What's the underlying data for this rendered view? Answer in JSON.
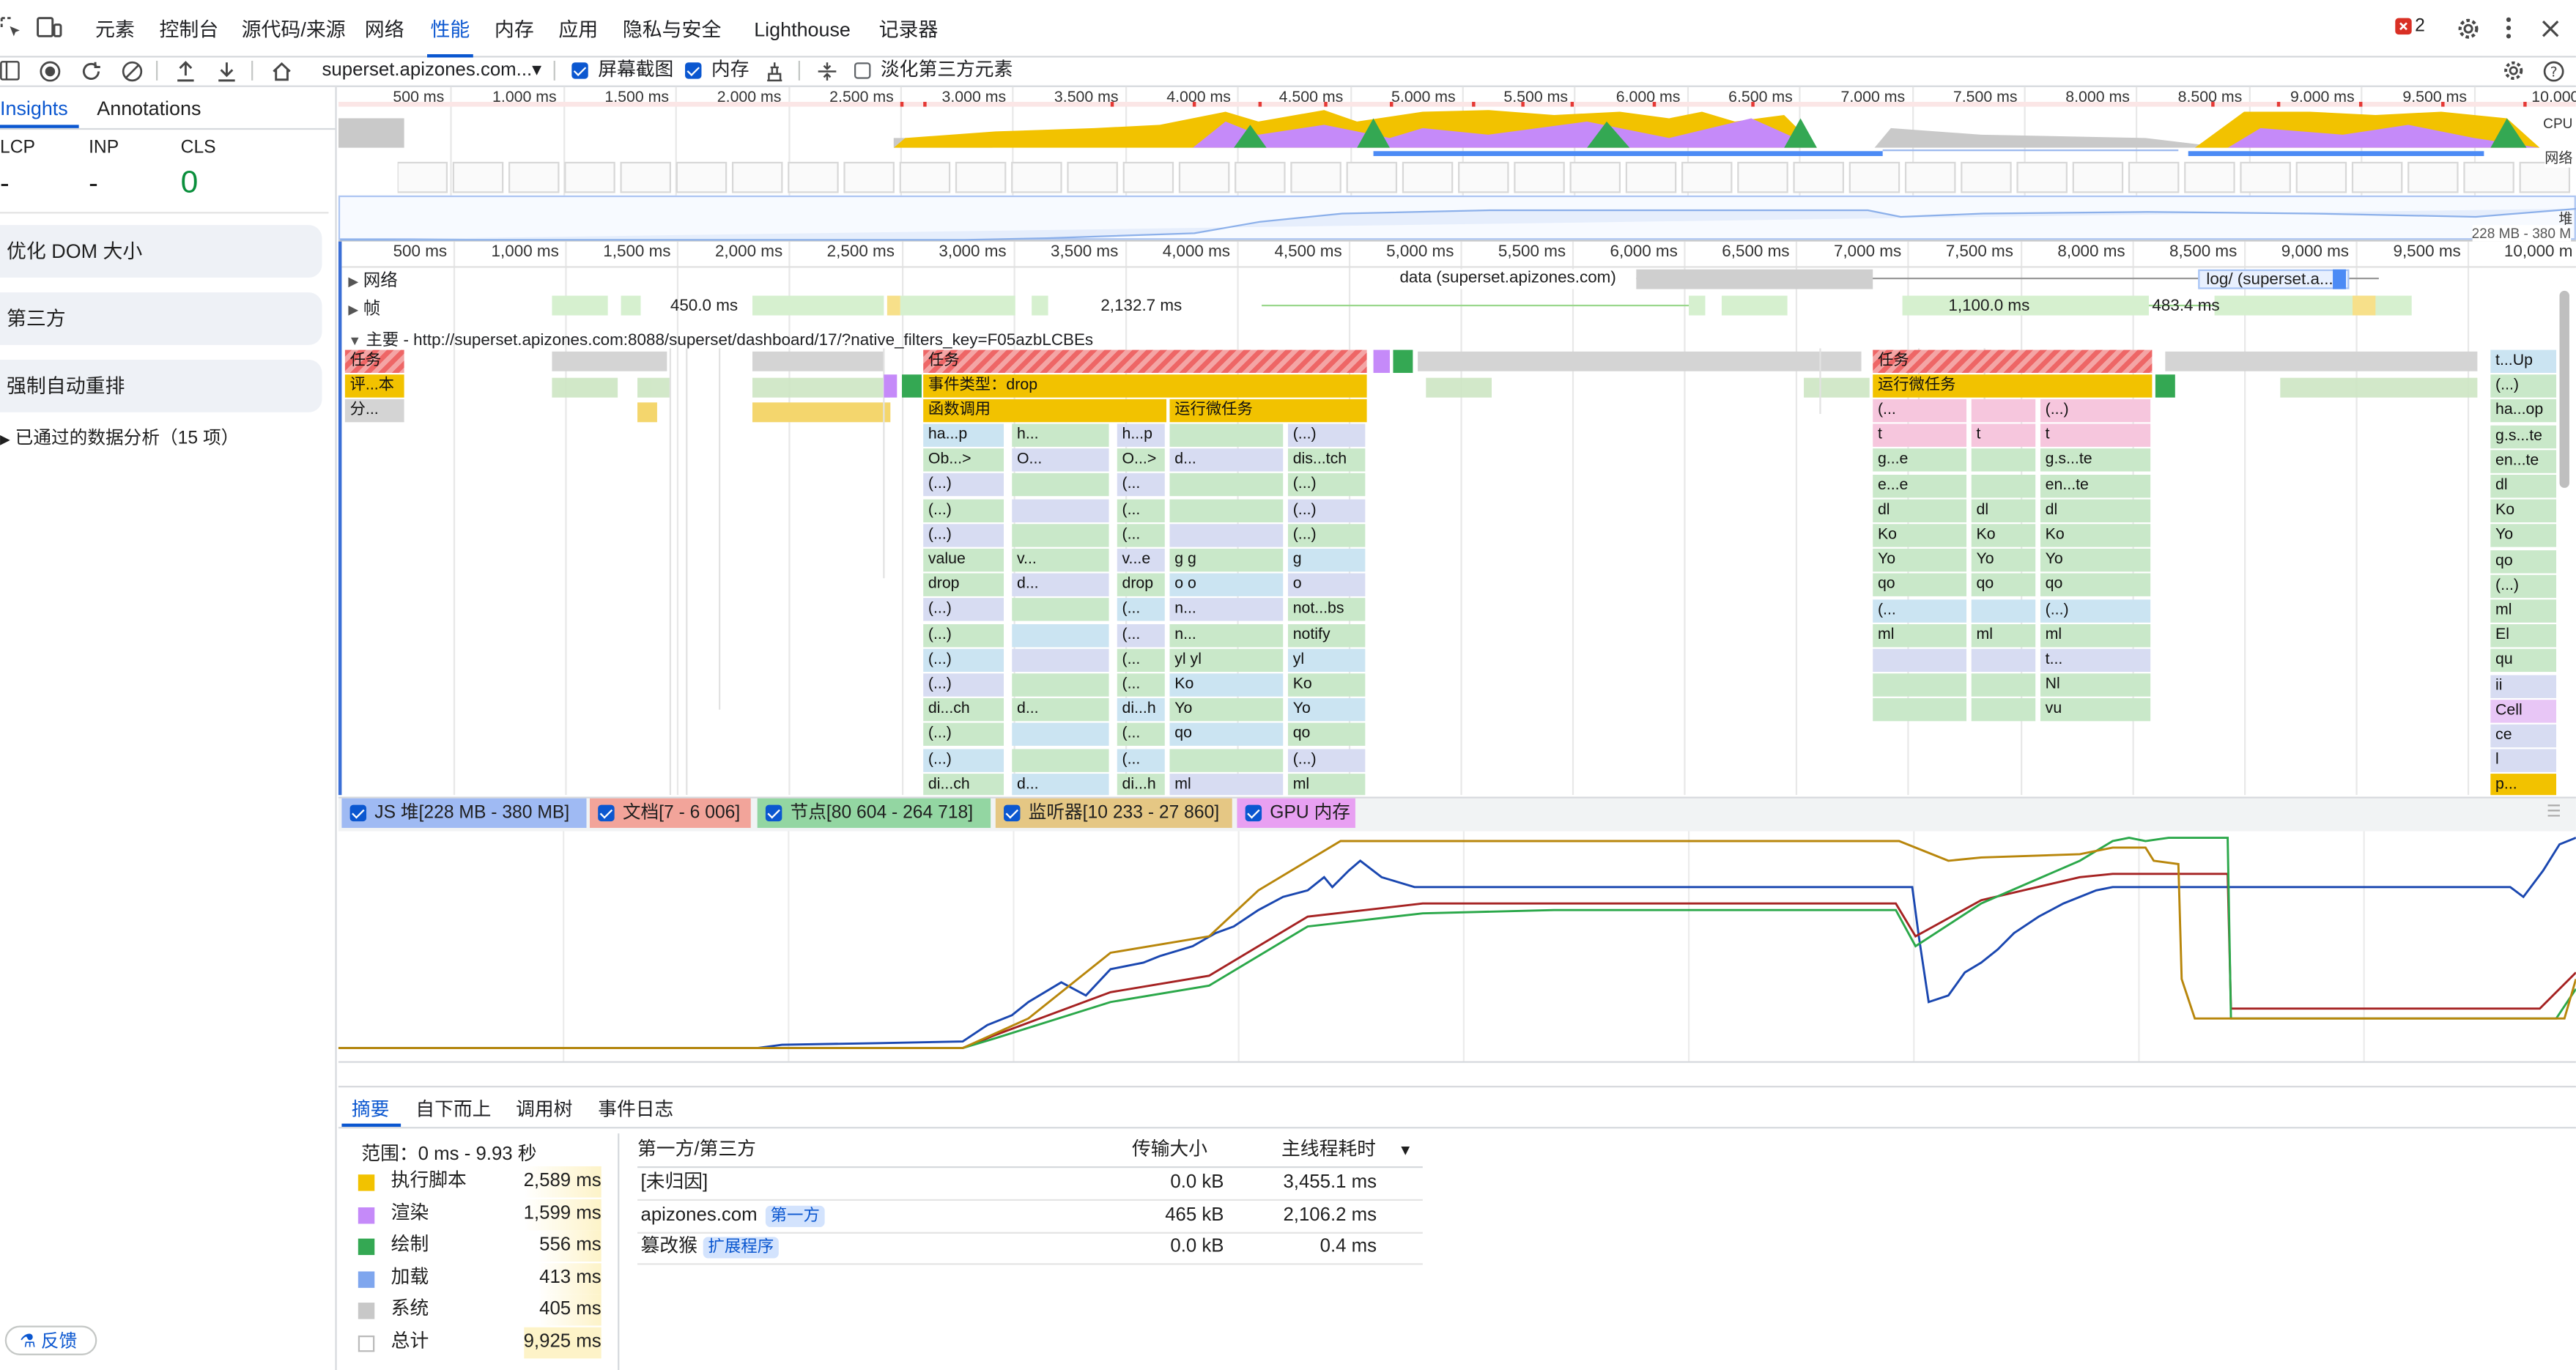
{
  "top_tabs": [
    "元素",
    "控制台",
    "源代码/来源",
    "网络",
    "性能",
    "内存",
    "应用",
    "隐私与安全",
    "Lighthouse",
    "记录器"
  ],
  "active_tab": "性能",
  "issues_count": "2",
  "toolbar": {
    "url_select": "superset.apizones.com...▾",
    "screenshots_label": "屏幕截图",
    "memory_label": "内存",
    "dim_third_party_label": "淡化第三方元素"
  },
  "sidebar": {
    "tabs": [
      "Insights",
      "Annotations"
    ],
    "metrics": [
      {
        "label": "LCP",
        "value": "-"
      },
      {
        "label": "INP",
        "value": "-"
      },
      {
        "label": "CLS",
        "value": "0"
      }
    ],
    "cards": [
      "优化 DOM 大小",
      "第三方",
      "强制自动重排"
    ],
    "passed_label": "已通过的数据分析（15 项）",
    "feedback_label": "反馈"
  },
  "overview": {
    "ticks": [
      "500 ms",
      "1,000 ms",
      "1,500 ms",
      "2,000 ms",
      "2,500 ms",
      "3,000 ms",
      "3,500 ms",
      "4,000 ms",
      "4,500 ms",
      "5,000 ms",
      "5,500 ms",
      "6,000 ms",
      "6,500 ms",
      "7,000 ms",
      "7,500 ms",
      "8,000 ms",
      "8,500 ms",
      "9,000 ms",
      "9,500 ms",
      "10,000"
    ],
    "cpu_label": "CPU",
    "net_label": "网络",
    "heap_label": "堆",
    "heap_range": "228 MB - 380 M"
  },
  "timeline": {
    "ticks": [
      "500 ms",
      "1,000 ms",
      "1,500 ms",
      "2,000 ms",
      "2,500 ms",
      "3,000 ms",
      "3,500 ms",
      "4,000 ms",
      "4,500 ms",
      "5,000 ms",
      "5,500 ms",
      "6,000 ms",
      "6,500 ms",
      "7,000 ms",
      "7,500 ms",
      "8,000 ms",
      "8,500 ms",
      "9,000 ms",
      "9,500 ms",
      "10,000 m"
    ],
    "network_track": "网络",
    "frames_track": "帧",
    "frame_times": [
      "450.0 ms",
      "2,132.7 ms",
      "1,100.0 ms",
      "483.4 ms"
    ],
    "net_requests": [
      "data (superset.apizones.com)",
      "log/ (superset.a..."
    ],
    "main_track": "主要 - http://superset.apizones.com:8088/superset/dashboard/17/?native_filters_key=F05azbLCBEs"
  },
  "flame": {
    "left": {
      "task": "任务",
      "r1": "评...本",
      "r2": "分..."
    },
    "mid": {
      "task": "任务",
      "event": "事件类型：drop",
      "func": "函数调用",
      "micro": "运行微任务",
      "rows": [
        [
          "ha...p",
          "h...",
          "h...p",
          "",
          "(...)"
        ],
        [
          "Ob...>",
          "O...",
          "O...>",
          "d...",
          "dis...tch"
        ],
        [
          "(...)",
          "",
          "(...",
          "",
          "(...)"
        ],
        [
          "(...)",
          "",
          "(...",
          "",
          "(...)"
        ],
        [
          "(...)",
          "",
          "(...",
          "",
          "(...)"
        ],
        [
          "value",
          "v...",
          "v...e",
          "g    g",
          "g"
        ],
        [
          "drop",
          "d...",
          "drop",
          "o    o",
          "o"
        ],
        [
          "(...)",
          "",
          "(...",
          "n...",
          "not...bs"
        ],
        [
          "(...)",
          "",
          "(...",
          "n...",
          "notify"
        ],
        [
          "(...)",
          "",
          "(...",
          "yl    yl",
          "yl"
        ],
        [
          "(...)",
          "",
          "(...",
          "Ko",
          "Ko"
        ],
        [
          "di...ch",
          "d...",
          "di...h",
          "Yo",
          "Yo"
        ],
        [
          "(...)",
          "",
          "(...",
          "qo",
          "qo"
        ],
        [
          "(...)",
          "",
          "(...",
          "",
          "(...)"
        ],
        [
          "di...ch",
          "d...",
          "di...h",
          "ml",
          "ml"
        ]
      ]
    },
    "right": {
      "task": "任务",
      "micro": "运行微任务",
      "rows": [
        [
          "(...",
          "",
          "(...)"
        ],
        [
          "t",
          "t",
          "t"
        ],
        [
          "g...e",
          "",
          "g.s...te"
        ],
        [
          "e...e",
          "",
          "en...te"
        ],
        [
          "dl",
          "dl",
          "dl"
        ],
        [
          "Ko",
          "Ko",
          "Ko"
        ],
        [
          "Yo",
          "Yo",
          "Yo"
        ],
        [
          "qo",
          "qo",
          "qo"
        ],
        [
          "(...",
          "",
          "(...)"
        ],
        [
          "ml",
          "ml",
          "ml"
        ],
        [
          "",
          "",
          "t..."
        ],
        [
          "",
          "",
          "Nl"
        ],
        [
          "",
          "",
          "vu"
        ]
      ]
    },
    "far": [
      "t...Up",
      "(...)",
      "ha...op",
      "g.s...te",
      "en...te",
      "dl",
      "Ko",
      "Yo",
      "qo",
      "(...)",
      "ml",
      "El",
      "qu",
      "ii",
      "Cell",
      "ce",
      "l",
      "p..."
    ]
  },
  "counters": [
    {
      "label": "JS 堆[228 MB - 380 MB]",
      "color": "#3862c6"
    },
    {
      "label": "文档[7 - 6 006]",
      "color": "#c23b22"
    },
    {
      "label": "节点[80 604 - 264 718]",
      "color": "#34a853"
    },
    {
      "label": "监听器[10 233 - 27 860]",
      "color": "#b8860b"
    },
    {
      "label": "GPU 内存",
      "color": "#c026d3"
    }
  ],
  "bottom_tabs": [
    "摘要",
    "自下而上",
    "调用树",
    "事件日志"
  ],
  "summary": {
    "range": "范围：0 ms - 9.93 秒",
    "items": [
      {
        "label": "执行脚本",
        "value": "2,589 ms",
        "color": "#f2c200"
      },
      {
        "label": "渲染",
        "value": "1,599 ms",
        "color": "#c58af9"
      },
      {
        "label": "绘制",
        "value": "556 ms",
        "color": "#34a853"
      },
      {
        "label": "加载",
        "value": "413 ms",
        "color": "#7fa6ee"
      },
      {
        "label": "系统",
        "value": "405 ms",
        "color": "#c8c8c8"
      },
      {
        "label": "总计",
        "value": "9,925 ms",
        "color": "#ffffff"
      }
    ]
  },
  "third_party": {
    "headers": [
      "第一方/第三方",
      "传输大小",
      "主线程耗时"
    ],
    "rows": [
      {
        "name": "[未归因]",
        "badge": "",
        "size": "0.0 kB",
        "time": "3,455.1 ms"
      },
      {
        "name": "apizones.com",
        "badge": "第一方",
        "size": "465 kB",
        "time": "2,106.2 ms"
      },
      {
        "name": "篡改猴",
        "badge": "扩展程序",
        "size": "0.0 kB",
        "time": "0.4 ms"
      }
    ]
  }
}
